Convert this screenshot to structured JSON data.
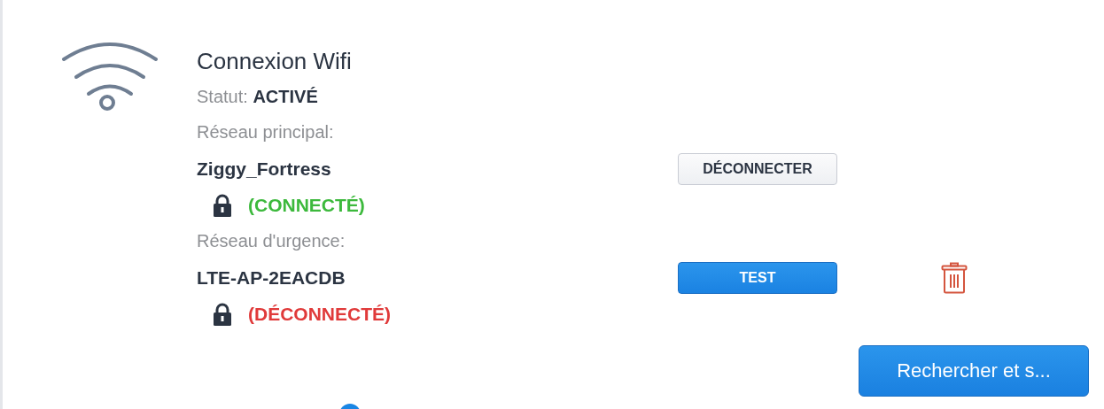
{
  "connection": {
    "title": "Connexion Wifi",
    "status_label": "Statut:",
    "status_value": "ACTIVÉ"
  },
  "networks": [
    {
      "label": "Réseau principal:",
      "name": "Ziggy_Fortress",
      "locked": true,
      "connected": true,
      "state": "(CONNECTÉ)",
      "button": {
        "label": "DÉCONNECTER",
        "kind": "secondary"
      },
      "deletable": false
    },
    {
      "label": "Réseau d'urgence:",
      "name": "LTE-AP-2EACDB",
      "locked": true,
      "connected": false,
      "state": "(DÉCONNECTÉ)",
      "button": {
        "label": "TEST",
        "kind": "primary"
      },
      "deletable": true
    }
  ],
  "search_button": {
    "label": "Rechercher et s..."
  }
}
